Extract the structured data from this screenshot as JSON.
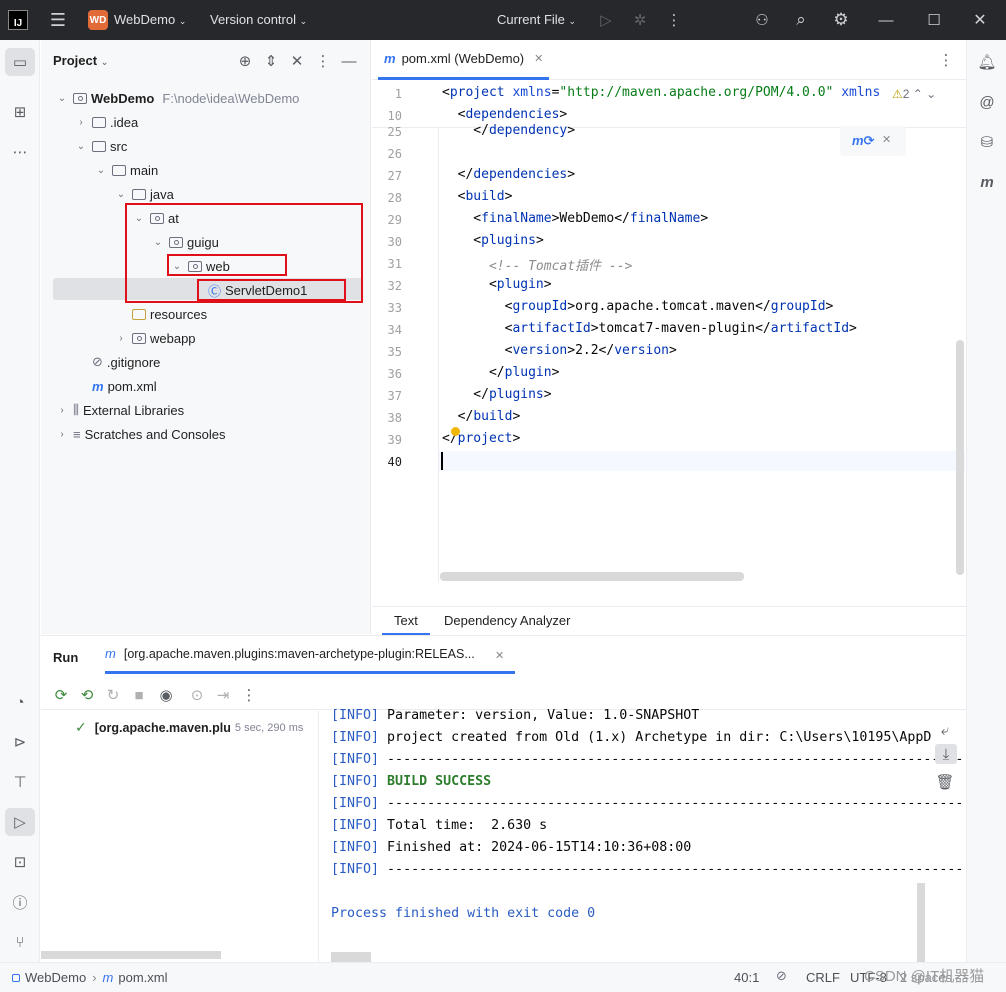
{
  "titlebar": {
    "logo": "IJ",
    "project_badge": "WD",
    "project_name": "WebDemo",
    "vcs": "Version control",
    "run_config": "Current File"
  },
  "project_panel": {
    "title": "Project",
    "tree": [
      {
        "label": "WebDemo",
        "path": "F:\\node\\idea\\WebDemo",
        "chev": "⌄"
      },
      {
        "label": ".idea",
        "chev": "›"
      },
      {
        "label": "src",
        "chev": "⌄"
      },
      {
        "label": "main",
        "chev": "⌄"
      },
      {
        "label": "java",
        "chev": "⌄"
      },
      {
        "label": "at",
        "chev": "⌄"
      },
      {
        "label": "guigu",
        "chev": "⌄"
      },
      {
        "label": "web",
        "chev": "⌄"
      },
      {
        "label": "ServletDemo1",
        "chev": ""
      },
      {
        "label": "resources",
        "chev": ""
      },
      {
        "label": "webapp",
        "chev": "›"
      },
      {
        "label": ".gitignore",
        "chev": ""
      },
      {
        "label": "pom.xml",
        "chev": ""
      },
      {
        "label": "External Libraries",
        "chev": "›"
      },
      {
        "label": "Scratches and Consoles",
        "chev": "›"
      }
    ]
  },
  "editor": {
    "tab_label": "pom.xml (WebDemo)",
    "warnings": "2",
    "sticky": [
      {
        "num": "1",
        "t": [
          [
            "",
            "<"
          ],
          [
            "tag",
            "project "
          ],
          [
            "attr",
            "xmlns"
          ],
          [
            "",
            "="
          ],
          [
            "str",
            "\"http://maven.apache.org/POM/4.0.0\" "
          ],
          [
            "attr",
            "xmlns"
          ]
        ]
      },
      {
        "num": "10",
        "t": [
          [
            "",
            "  <"
          ],
          [
            "tag",
            "dependencies"
          ],
          [
            "",
            ">"
          ]
        ]
      }
    ],
    "lines": [
      {
        "num": "25",
        "t": [
          [
            "",
            "    </"
          ],
          [
            "tag",
            "dependency"
          ],
          [
            "",
            ">"
          ]
        ]
      },
      {
        "num": "26",
        "t": []
      },
      {
        "num": "27",
        "t": [
          [
            "",
            "  </"
          ],
          [
            "tag",
            "dependencies"
          ],
          [
            "",
            ">"
          ]
        ]
      },
      {
        "num": "28",
        "t": [
          [
            "",
            "  <"
          ],
          [
            "tag",
            "build"
          ],
          [
            "",
            ">"
          ]
        ]
      },
      {
        "num": "29",
        "t": [
          [
            "",
            "    <"
          ],
          [
            "tag",
            "finalName"
          ],
          [
            "",
            ">WebDemo</"
          ],
          [
            "tag",
            "finalName"
          ],
          [
            "",
            ">"
          ]
        ]
      },
      {
        "num": "30",
        "t": [
          [
            "",
            "    <"
          ],
          [
            "tag",
            "plugins"
          ],
          [
            "",
            ">"
          ]
        ]
      },
      {
        "num": "31",
        "t": [
          [
            "",
            "      "
          ],
          [
            "cmt",
            "<!-- Tomcat插件 -->"
          ]
        ]
      },
      {
        "num": "32",
        "t": [
          [
            "",
            "      <"
          ],
          [
            "tag",
            "plugin"
          ],
          [
            "",
            ">"
          ]
        ]
      },
      {
        "num": "33",
        "t": [
          [
            "",
            "        <"
          ],
          [
            "tag",
            "groupId"
          ],
          [
            "",
            ">org.apache.tomcat.maven</"
          ],
          [
            "tag",
            "groupId"
          ],
          [
            "",
            ">"
          ]
        ]
      },
      {
        "num": "34",
        "t": [
          [
            "",
            "        <"
          ],
          [
            "tag",
            "artifactId"
          ],
          [
            "",
            ">tomcat7-maven-plugin</"
          ],
          [
            "tag",
            "artifactId"
          ],
          [
            "",
            ">"
          ]
        ]
      },
      {
        "num": "35",
        "t": [
          [
            "",
            "        <"
          ],
          [
            "tag",
            "version"
          ],
          [
            "",
            ">2.2</"
          ],
          [
            "tag",
            "version"
          ],
          [
            "",
            ">"
          ]
        ]
      },
      {
        "num": "36",
        "t": [
          [
            "",
            "      </"
          ],
          [
            "tag",
            "plugin"
          ],
          [
            "",
            ">"
          ]
        ]
      },
      {
        "num": "37",
        "t": [
          [
            "",
            "    </"
          ],
          [
            "tag",
            "plugins"
          ],
          [
            "",
            ">"
          ]
        ]
      },
      {
        "num": "38",
        "t": [
          [
            "",
            "  </"
          ],
          [
            "tag",
            "build"
          ],
          [
            "",
            ">"
          ]
        ]
      },
      {
        "num": "39",
        "t": [
          [
            "",
            "</"
          ],
          [
            "tag",
            "project"
          ],
          [
            "",
            ">"
          ]
        ]
      },
      {
        "num": "40",
        "t": []
      }
    ],
    "bottom_tabs": [
      "Text",
      "Dependency Analyzer"
    ]
  },
  "run_panel": {
    "title": "Run",
    "tab_label": "[org.apache.maven.plugins:maven-archetype-plugin:RELEAS...",
    "item_label": "[org.apache.maven.plu",
    "item_time": "5 sec, 290 ms",
    "console": [
      [
        "[INFO]",
        " Parameter: version, Value: 1.0-SNAPSHOT"
      ],
      [
        "[INFO]",
        " project created from Old (1.x) Archetype in dir: C:\\Users\\10195\\AppD"
      ],
      [
        "[INFO]",
        " ------------------------------------------------------------------------"
      ],
      [
        "[INFO]",
        " BUILD SUCCESS"
      ],
      [
        "[INFO]",
        " ------------------------------------------------------------------------"
      ],
      [
        "[INFO]",
        " Total time:  2.630 s"
      ],
      [
        "[INFO]",
        " Finished at: 2024-06-15T14:10:36+08:00"
      ],
      [
        "[INFO]",
        " ------------------------------------------------------------------------"
      ],
      [
        "",
        ""
      ],
      [
        "",
        "Process finished with exit code 0"
      ]
    ]
  },
  "statusbar": {
    "crumb_project": "WebDemo",
    "crumb_file": "pom.xml",
    "position": "40:1",
    "line_sep": "CRLF",
    "encoding": "UTF-8",
    "indent": "2 spaces",
    "watermark": "CSDN @IT机器猫"
  }
}
